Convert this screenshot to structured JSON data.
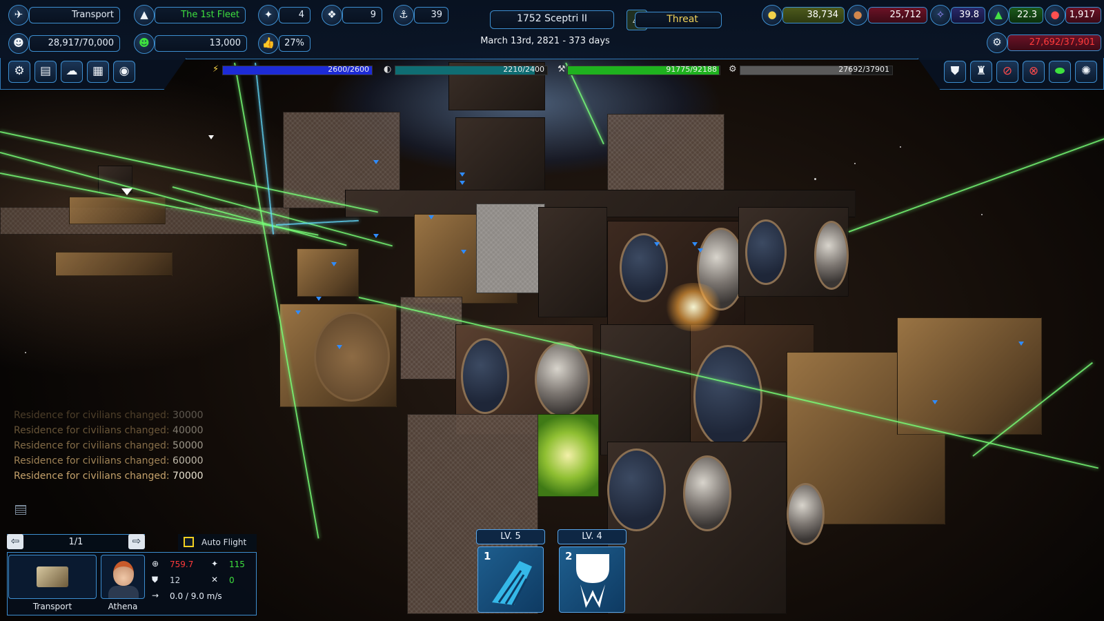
{
  "top": {
    "ship_name": "Transport",
    "fleet_name": "The 1st Fleet",
    "count_fighters": "4",
    "count_ships": "9",
    "count_stations": "39",
    "population": "28,917/70,000",
    "crew": "13,000",
    "approval": "27%",
    "location": "1752 Sceptri II",
    "threat_label": "Threat",
    "date": "March 13rd, 2821 - 373 days"
  },
  "resources": {
    "credits": "38,734",
    "ore": "25,712",
    "crystal": "39.8",
    "bio": "22.3",
    "fuel": "1,917",
    "storage": "27,692/37,901"
  },
  "bars": {
    "energy": {
      "text": "2600/2600",
      "fraction": 1.0,
      "color": "#1d2bd6"
    },
    "shield": {
      "text": "2210/2400",
      "fraction": 0.92,
      "color": "#0f6d73"
    },
    "hull": {
      "text": "91775/92188",
      "fraction": 0.995,
      "color": "#1fb21f"
    },
    "cargo": {
      "text": "27692/37901",
      "fraction": 0.73,
      "color": "#5a5a5a"
    }
  },
  "log": [
    {
      "text": "Residence for civilians changed: ",
      "value": "30000",
      "opacity": 0.35
    },
    {
      "text": "Residence for civilians changed: ",
      "value": "40000",
      "opacity": 0.5
    },
    {
      "text": "Residence for civilians changed: ",
      "value": "50000",
      "opacity": 0.65
    },
    {
      "text": "Residence for civilians changed: ",
      "value": "60000",
      "opacity": 0.8
    },
    {
      "text": "Residence for civilians changed: ",
      "value": "70000",
      "opacity": 1.0
    }
  ],
  "unit_panel": {
    "pager": "1/1",
    "auto_flight_label": "Auto Flight",
    "ship_label": "Transport",
    "captain_label": "Athena",
    "stat_attack": "759.7",
    "stat_fighters": "115",
    "stat_defense": "12",
    "stat_repair": "0",
    "speed": "0.0 / 9.0 m/s"
  },
  "skills": [
    {
      "level": "LV. 5",
      "number": "1"
    },
    {
      "level": "LV. 4",
      "number": "2"
    }
  ],
  "icons": {
    "top_left": [
      "transport-ship-icon",
      "fleet-icon",
      "fighter-icon",
      "ship-icon",
      "station-icon",
      "population-icon",
      "crew-icon",
      "approval-icon"
    ],
    "tools_left": [
      "settings-icon",
      "documents-icon",
      "brain-icon",
      "news-icon",
      "signal-icon"
    ],
    "tools_right": [
      "shield-icon",
      "factory-icon",
      "no-missile-icon",
      "no-weapon-icon",
      "green-planet-icon",
      "starfield-icon"
    ]
  }
}
